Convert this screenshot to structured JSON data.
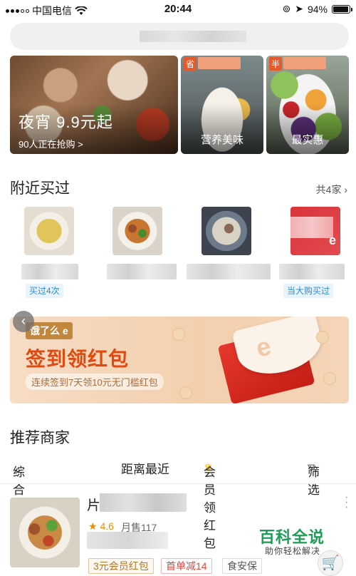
{
  "status_bar": {
    "carrier": "中国电信",
    "time": "20:44",
    "battery": "94%",
    "battery_level": 0.94
  },
  "banners": {
    "main_title": "夜宵 9.9元起",
    "main_subtitle": "90人正在抢购 >",
    "card2_tag": "省",
    "card2_caption": "营养美味",
    "card3_tag": "半",
    "card3_caption": "最实惠"
  },
  "nearby": {
    "title": "附近买过",
    "more": "共4家 ›",
    "badge_left": "买过4次",
    "badge_right": "当大购买过"
  },
  "promo": {
    "logo": "e",
    "title": "签到领红包",
    "subtitle": "连续签到7天领10元无门槛红包"
  },
  "recommend": {
    "title": "推荐商家",
    "filters": {
      "sort": "综合排序",
      "distance": "距离最近",
      "vip": "会员领红包",
      "filter": "筛选"
    }
  },
  "merchant": {
    "initial": "片",
    "rating": "4.6",
    "monthly_sales": "月售117",
    "chips": [
      "3元会员红包",
      "首单减14",
      "食安保"
    ]
  },
  "watermark": {
    "title": "百科全说",
    "subtitle": "助你轻松解决"
  },
  "icons": {
    "back": "‹",
    "more": "⋮",
    "cart": "🛒",
    "star": "★",
    "crown": "♛",
    "funnel": "▽",
    "chevron": "⌄"
  }
}
